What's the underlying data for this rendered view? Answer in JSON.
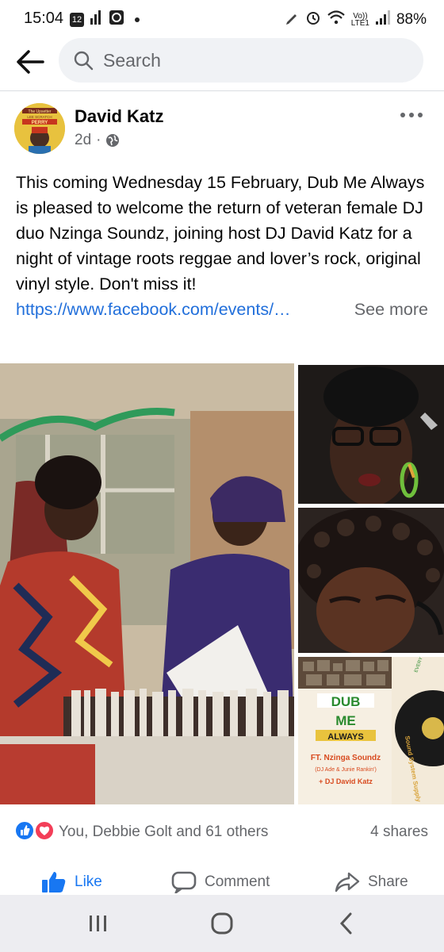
{
  "status_bar": {
    "time": "15:04",
    "notif_badge": "12",
    "lte_top": "Vo))",
    "lte_bottom": "LTE1",
    "battery": "88%"
  },
  "search": {
    "placeholder": "Search"
  },
  "post": {
    "author": "David Katz",
    "age": "2d",
    "dot": "·",
    "text": "This coming Wednesday 15 February, Dub Me Always is pleased to welcome the return of veteran female DJ duo Nzinga Soundz, joining host DJ David Katz for a night of vintage roots reggae and lover’s rock, original vinyl style. Don't miss it!",
    "link": "https://www.facebook.com/events/…",
    "see_more": "See more"
  },
  "avatar": {
    "banner_top": "The Upsetter",
    "banner_mid": "LEE SCRATCH",
    "banner_name": "PERRY"
  },
  "poster": {
    "title_1": "DUB",
    "title_2": "ME",
    "title_3": "ALWAYS",
    "feat": "FT. Nzinga Soundz",
    "feat_sub": "(DJ Ade & Junie Rankin')",
    "host": "+ DJ David Katz",
    "side_1": "Sound System Supply",
    "side_2": "EVERY 3RD WED OF THE MONTH"
  },
  "engagement": {
    "reactions_text": "You, Debbie Golt and 61 others",
    "shares": "4 shares"
  },
  "actions": {
    "like": "Like",
    "comment": "Comment",
    "share": "Share"
  },
  "colors": {
    "facebook_blue": "#1877f2",
    "link_blue": "#216fdb",
    "love_red": "#f33e58",
    "secondary_text": "#65676b"
  }
}
